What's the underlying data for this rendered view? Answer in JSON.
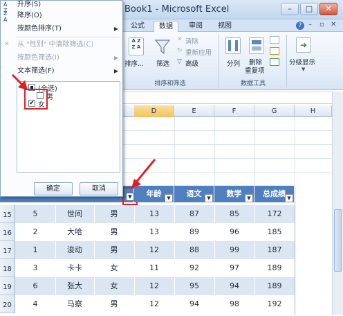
{
  "window": {
    "title": "Book1 - Microsoft Excel",
    "buttons": [
      "–",
      "□",
      "✕"
    ]
  },
  "ribbon_tabs": [
    {
      "label": "公式",
      "active": false
    },
    {
      "label": "数据",
      "active": true
    },
    {
      "label": "审阅",
      "active": false
    },
    {
      "label": "视图",
      "active": false
    }
  ],
  "ribbon": {
    "sort_label": "排序...",
    "filter_label": "筛选",
    "clear_label": "清除",
    "reapply_label": "重新应用",
    "advanced_label": "高级",
    "group_sort_filter": "排序和筛选",
    "split_label": "分列",
    "remove_dup_label": "删除\n重复项",
    "remove_dup_line1": "删除",
    "remove_dup_line2": "重复项",
    "group_data_tools": "数据工具",
    "outline_label": "分级显示"
  },
  "filter_menu": {
    "items": [
      {
        "label": "升序(S)",
        "disabled": false,
        "arrow": false
      },
      {
        "label": "降序(O)",
        "disabled": false,
        "arrow": false
      },
      {
        "label": "按颜色排序(T)",
        "disabled": false,
        "arrow": true
      },
      {
        "label": "从 \"性别\" 中清除筛选(C)",
        "disabled": true,
        "arrow": false
      },
      {
        "label": "按颜色筛选(I)",
        "disabled": true,
        "arrow": true
      },
      {
        "label": "文本筛选(F)",
        "disabled": false,
        "arrow": true
      }
    ],
    "list": [
      {
        "label": "(全选)",
        "state": "partial"
      },
      {
        "label": "男",
        "state": "unchecked"
      },
      {
        "label": "女",
        "state": "checked"
      }
    ],
    "ok_label": "确定",
    "cancel_label": "取消"
  },
  "columns": [
    "D",
    "E",
    "F",
    "G",
    "H"
  ],
  "selected_column": "D",
  "table": {
    "headers": [
      "年龄",
      "语文",
      "数学",
      "总成绩"
    ],
    "rows": [
      {
        "row_number": "15",
        "id": "5",
        "name": "世间",
        "gender": "男",
        "age": "13",
        "chinese": "87",
        "math": "85",
        "total": "172"
      },
      {
        "row_number": "16",
        "id": "2",
        "name": "大哈",
        "gender": "男",
        "age": "13",
        "chinese": "89",
        "math": "96",
        "total": "185"
      },
      {
        "row_number": "17",
        "id": "1",
        "name": "浚动",
        "gender": "男",
        "age": "12",
        "chinese": "88",
        "math": "99",
        "total": "187"
      },
      {
        "row_number": "18",
        "id": "3",
        "name": "卡卡",
        "gender": "女",
        "age": "11",
        "chinese": "92",
        "math": "97",
        "total": "189"
      },
      {
        "row_number": "19",
        "id": "6",
        "name": "张大",
        "gender": "女",
        "age": "12",
        "chinese": "95",
        "math": "94",
        "total": "189"
      },
      {
        "row_number": "20",
        "id": "4",
        "name": "马察",
        "gender": "男",
        "age": "12",
        "chinese": "94",
        "math": "98",
        "total": "192"
      }
    ]
  },
  "colors": {
    "header_blue": "#4f7fbf",
    "band_light": "#dce6f2",
    "band_white": "#ffffff",
    "annotation_red": "#e01f1f",
    "selected_column": "#f2c25d"
  }
}
